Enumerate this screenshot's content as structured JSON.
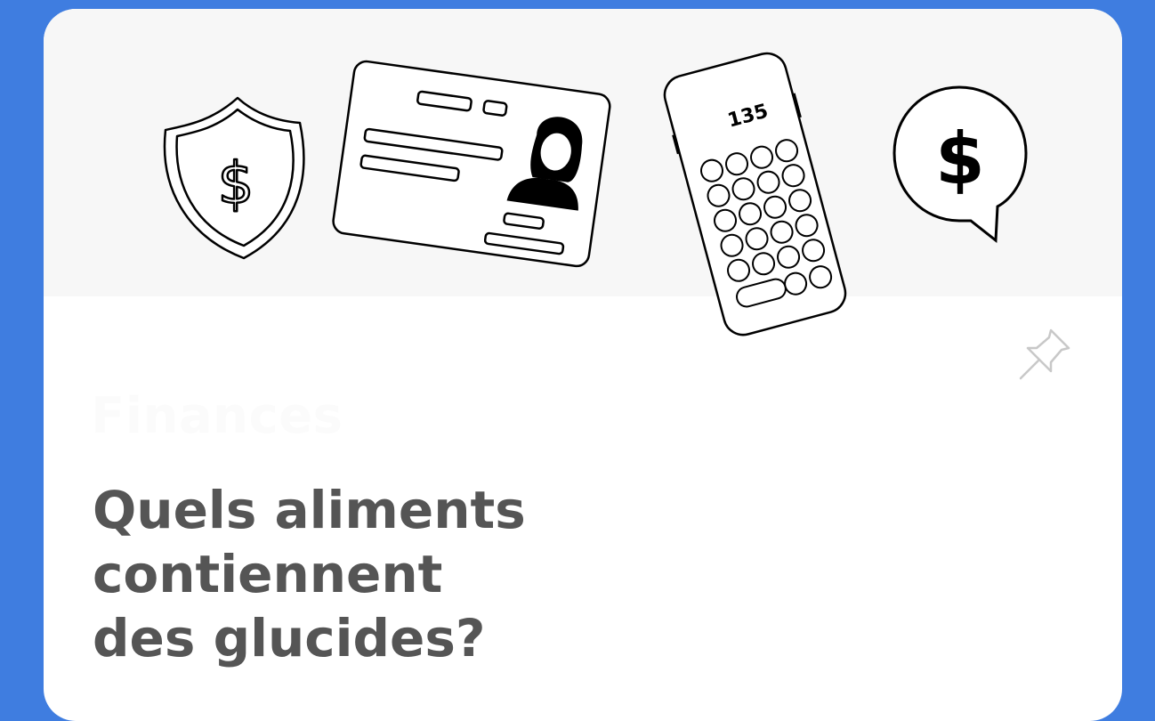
{
  "card": {
    "category": "Finances",
    "title_line1": "Quels aliments contiennent",
    "title_line2": "des glucides?",
    "calculator_display": "135"
  },
  "icons": [
    "shield-dollar-icon",
    "id-card-icon",
    "calculator-phone-icon",
    "speech-bubble-dollar-icon",
    "pin-icon"
  ],
  "colors": {
    "background": "#3f7de0",
    "card": "#ffffff",
    "hero": "#f7f7f7",
    "title": "#555555",
    "category": "#fbfbfb"
  }
}
